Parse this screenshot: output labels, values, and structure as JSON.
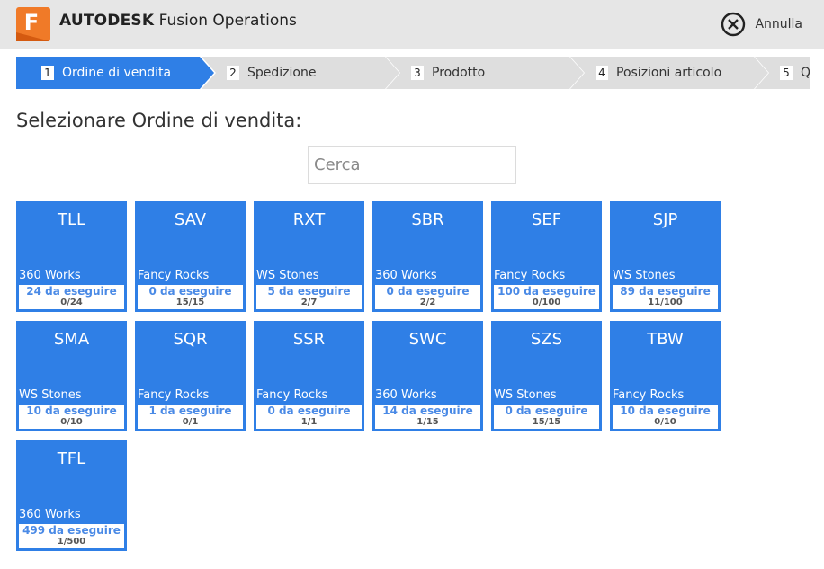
{
  "header": {
    "logo_letter": "F",
    "brand_bold": "AUTODESK",
    "brand_rest": "Fusion Operations",
    "cancel_label": "Annulla",
    "cancel_icon": "close-circle-icon",
    "accent_color": "#f07a28"
  },
  "steps": [
    {
      "num": "1",
      "label": "Ordine di vendita",
      "active": true
    },
    {
      "num": "2",
      "label": "Spedizione",
      "active": false
    },
    {
      "num": "3",
      "label": "Prodotto",
      "active": false
    },
    {
      "num": "4",
      "label": "Posizioni articolo",
      "active": false
    },
    {
      "num": "5",
      "label": "Q",
      "active": false
    }
  ],
  "prompt": "Selezionare Ordine di vendita:",
  "search": {
    "placeholder": "Cerca",
    "value": ""
  },
  "colors": {
    "tile": "#2f7fe6",
    "todo_text": "#4a8ae6",
    "header_bg": "#e6e6e6"
  },
  "orders": [
    {
      "code": "TLL",
      "customer": "360 Works",
      "todo": "24 da eseguire",
      "progress": "0/24"
    },
    {
      "code": "SAV",
      "customer": "Fancy Rocks",
      "todo": "0 da eseguire",
      "progress": "15/15"
    },
    {
      "code": "RXT",
      "customer": "WS Stones",
      "todo": "5 da eseguire",
      "progress": "2/7"
    },
    {
      "code": "SBR",
      "customer": "360 Works",
      "todo": "0 da eseguire",
      "progress": "2/2"
    },
    {
      "code": "SEF",
      "customer": "Fancy Rocks",
      "todo": "100 da eseguire",
      "progress": "0/100"
    },
    {
      "code": "SJP",
      "customer": "WS Stones",
      "todo": "89 da eseguire",
      "progress": "11/100"
    },
    {
      "code": "SMA",
      "customer": "WS Stones",
      "todo": "10 da eseguire",
      "progress": "0/10"
    },
    {
      "code": "SQR",
      "customer": "Fancy Rocks",
      "todo": "1 da eseguire",
      "progress": "0/1"
    },
    {
      "code": "SSR",
      "customer": "Fancy Rocks",
      "todo": "0 da eseguire",
      "progress": "1/1"
    },
    {
      "code": "SWC",
      "customer": "360 Works",
      "todo": "14 da eseguire",
      "progress": "1/15"
    },
    {
      "code": "SZS",
      "customer": "WS Stones",
      "todo": "0 da eseguire",
      "progress": "15/15"
    },
    {
      "code": "TBW",
      "customer": "Fancy Rocks",
      "todo": "10 da eseguire",
      "progress": "0/10"
    },
    {
      "code": "TFL",
      "customer": "360 Works",
      "todo": "499 da eseguire",
      "progress": "1/500"
    }
  ]
}
